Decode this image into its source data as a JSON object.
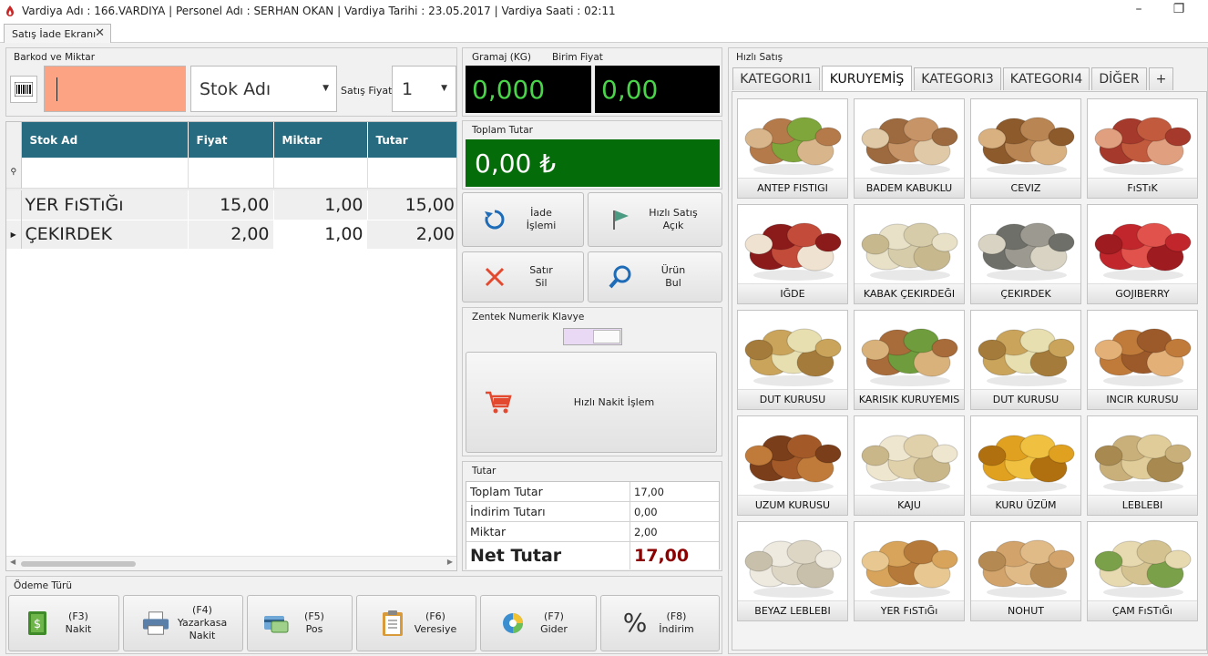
{
  "window": {
    "title": "Vardiya Adı : 166.VARDIYA | Personel Adı : SERHAN OKAN | Vardiya Tarihi : 23.05.2017 | Vardiya Saati : 02:11",
    "minimize": "–",
    "restore": "❐"
  },
  "doc_tab": {
    "label": "Satış İade Ekranı",
    "close": "✕"
  },
  "barkod": {
    "group_title": "Barkod ve Miktar",
    "stok_placeholder": "Stok Adı",
    "fiyat_label": "Satış Fiyat",
    "qty_value": "1"
  },
  "grid": {
    "columns": [
      "Stok Ad",
      "Fiyat",
      "Miktar",
      "Tutar"
    ],
    "rows": [
      {
        "name": "YER FıSTıĞı",
        "fiyat": "15,00",
        "miktar": "1,00",
        "tutar": "15,00"
      },
      {
        "name": "ÇEKIRDEK",
        "fiyat": "2,00",
        "miktar": "1,00",
        "tutar": "2,00"
      }
    ]
  },
  "scale": {
    "gramaj_label": "Gramaj (KG)",
    "birim_label": "Birim Fiyat",
    "gramaj_value": "0,000",
    "birim_value": "0,00"
  },
  "toplam": {
    "title": "Toplam Tutar",
    "value": "0,00 ₺"
  },
  "actions": {
    "iade": "İade\nİşlemi",
    "hizli_satis": "Hızlı Satış\nAçık",
    "satir_sil": "Satır\nSil",
    "urun_bul": "Ürün\nBul"
  },
  "keypad": {
    "title": "Zentek Numerik Klavye",
    "hizli_nakit": "Hızlı Nakit İşlem"
  },
  "tutar": {
    "title": "Tutar",
    "rows": [
      {
        "k": "Toplam Tutar",
        "v": "17,00"
      },
      {
        "k": "İndirim Tutarı",
        "v": "0,00"
      },
      {
        "k": "Miktar",
        "v": "2,00"
      }
    ],
    "net_label": "Net Tutar",
    "net_value": "17,00"
  },
  "odeme": {
    "title": "Ödeme Türü",
    "buttons": [
      {
        "key": "(F3)",
        "label": "Nakit"
      },
      {
        "key": "(F4)",
        "label": "Yazarkasa\nNakit"
      },
      {
        "key": "(F5)",
        "label": "Pos"
      },
      {
        "key": "(F6)",
        "label": "Veresiye"
      },
      {
        "key": "(F7)",
        "label": "Gider"
      },
      {
        "key": "(F8)",
        "label": "İndirim"
      }
    ]
  },
  "hizli": {
    "title": "Hızlı Satış",
    "tabs": [
      "KATEGORI1",
      "KURUYEMİŞ",
      "KATEGORI3",
      "KATEGORI4",
      "DİĞER",
      "+"
    ],
    "active_tab": 1,
    "products": [
      "ANTEP FISTIGI",
      "BADEM KABUKLU",
      "CEVIZ",
      "FıSTıK",
      "IĞDE",
      "KABAK ÇEKIRDEĞI",
      "ÇEKIRDEK",
      "GOJIBERRY",
      "DUT KURUSU",
      "KARISIK KURUYEMIS",
      "DUT KURUSU",
      "INCIR KURUSU",
      "UZUM KURUSU",
      "KAJU",
      "KURU ÜZÜM",
      "LEBLEBI",
      "BEYAZ LEBLEBI",
      "YER FıSTıĞı",
      "NOHUT",
      "ÇAM FıSTıĞı"
    ]
  },
  "colors": {
    "header_teal": "#266b7f",
    "barcode_input": "#fba382",
    "toplam_green": "#046d0a",
    "lcd_text": "#49d449",
    "net_red": "#8b0000"
  }
}
